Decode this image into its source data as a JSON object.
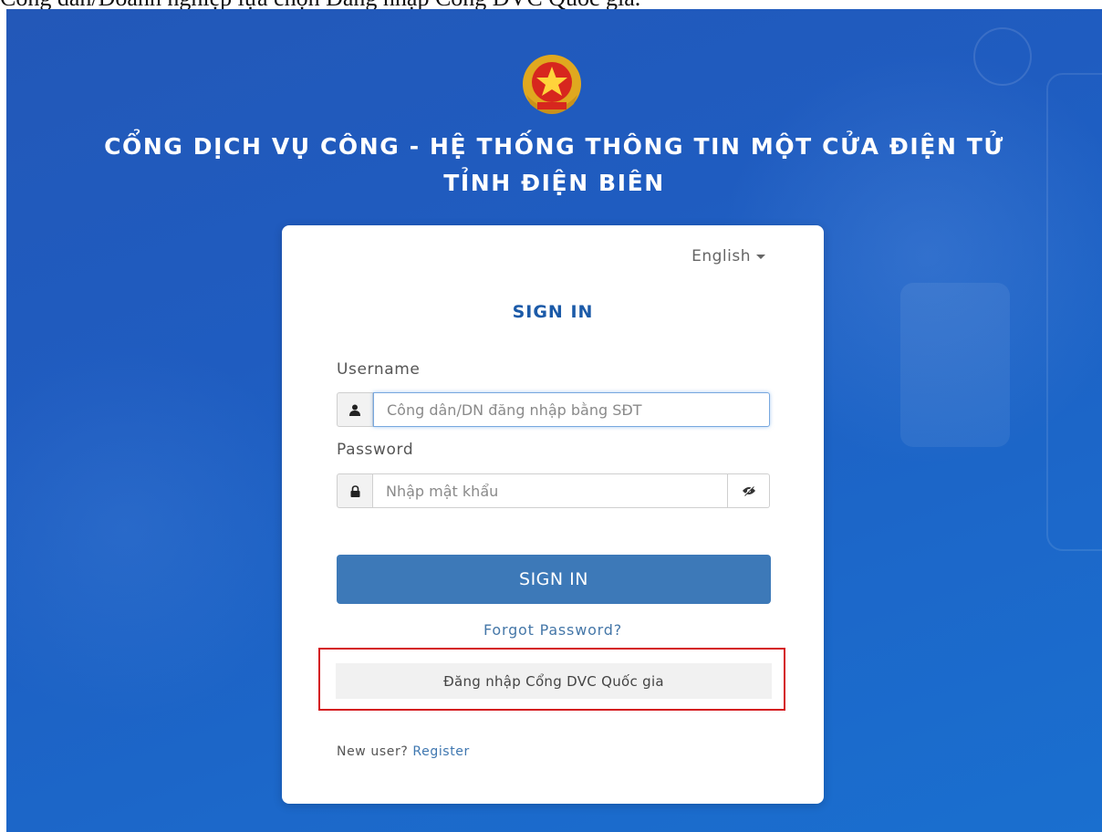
{
  "caption": "Công dân/Doanh nghiệp lựa chọn Đăng nhập Cổng DVC Quốc gia.",
  "header": {
    "title_line1": "CỔNG DỊCH VỤ CÔNG - HỆ THỐNG THÔNG TIN MỘT CỬA ĐIỆN TỬ",
    "title_line2": "TỈNH ĐIỆN BIÊN",
    "emblem_icon": "national-emblem-icon"
  },
  "login": {
    "language": "English",
    "heading": "SIGN IN",
    "username_label": "Username",
    "username_placeholder": "Công dân/DN đăng nhập bằng SĐT",
    "username_value": "",
    "password_label": "Password",
    "password_placeholder": "Nhập mật khẩu",
    "password_value": "",
    "signin_button": "SIGN IN",
    "forgot_link": "Forgot Password?",
    "national_portal_button": "Đăng nhập Cổng DVC Quốc gia",
    "new_user_text": "New user?",
    "register_link": "Register"
  },
  "colors": {
    "background": "#1f5cc0",
    "brand_heading": "#1b5aa8",
    "signin_button": "#3d79b8",
    "highlight_box": "#d4161c"
  },
  "icons": {
    "user": "user-icon",
    "lock": "lock-icon",
    "eye": "eye-slash-icon",
    "caret": "caret-down-icon"
  }
}
